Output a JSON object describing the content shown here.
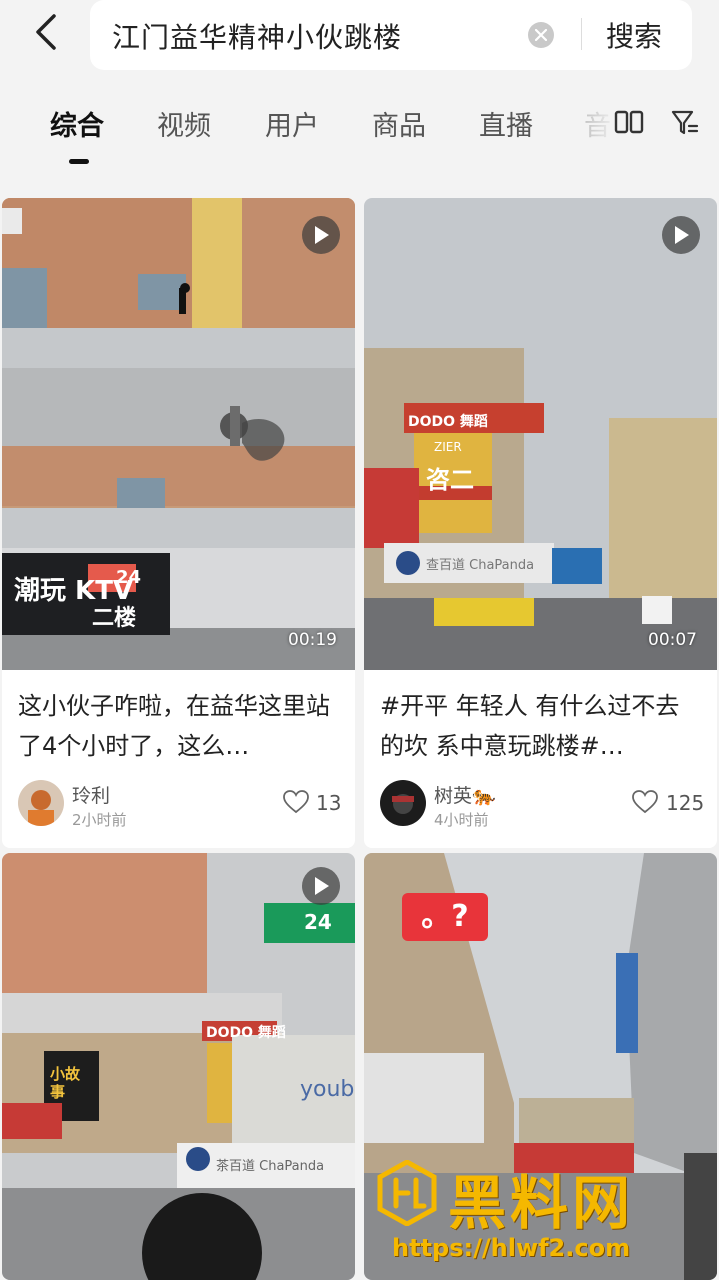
{
  "search": {
    "query": "江门益华精神小伙跳楼",
    "button_label": "搜索"
  },
  "tabs": [
    "综合",
    "视频",
    "用户",
    "商品",
    "直播",
    "音"
  ],
  "active_tab": "综合",
  "icons": {
    "back": "chevron-left-icon",
    "clear": "clear-icon",
    "layout": "grid-view-icon",
    "filter": "filter-icon",
    "play": "play-icon",
    "heart": "heart-icon"
  },
  "cards": [
    {
      "title": "这小伙子咋啦，在益华这里站了4个小时了，这么…",
      "duration": "00:19",
      "author": "玲利",
      "time": "2小时前",
      "likes": "13",
      "thumb_sign_1": "潮玩 KTV",
      "thumb_sign_2": "二楼",
      "thumb_sign_3": "24"
    },
    {
      "title": "#开平 年轻人 有什么过不去的坎 系中意玩跳楼#…",
      "duration": "00:07",
      "author": "树英",
      "author_emoji": "🐅",
      "time": "4小时前",
      "likes": "125",
      "thumb_sign_1": "DODO 舞蹈",
      "thumb_sign_2": "咨二",
      "thumb_sign_3": "ZIER",
      "thumb_sign_4": "查百道 ChaPanda"
    },
    {
      "thumb_sign_1": "DODO 舞蹈",
      "thumb_sign_2": "小故事",
      "thumb_sign_3": "youb",
      "thumb_sign_4": "茶百道 ChaPanda",
      "thumb_sign_5": "24"
    },
    {
      "badge": "。?"
    }
  ],
  "watermark": {
    "text": "黑料网",
    "url": "https://hlwf2.com"
  },
  "colors": {
    "background": "#f3f3f3",
    "badge_red": "#e8343a",
    "watermark_gold": "#f5b800"
  }
}
